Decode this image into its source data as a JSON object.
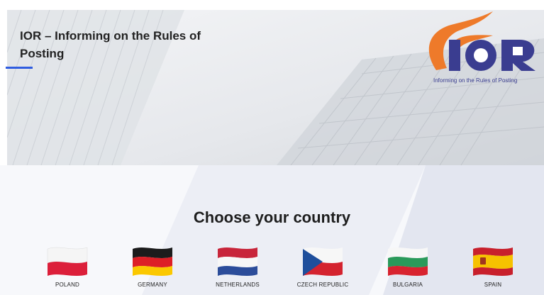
{
  "hero": {
    "title": "IOR – Informing on the Rules of Posting",
    "accent_color": "#2f5ce0"
  },
  "logo": {
    "letters": "IOR",
    "tagline": "Informing on the Rules of Posting",
    "colors": {
      "orange": "#ee7a2a",
      "navy": "#3a3d90"
    }
  },
  "section": {
    "heading": "Choose your country"
  },
  "countries": [
    {
      "name": "POLAND",
      "flag": "pl"
    },
    {
      "name": "GERMANY",
      "flag": "de"
    },
    {
      "name": "NETHERLANDS",
      "flag": "nl"
    },
    {
      "name": "CZECH REPUBLIC",
      "flag": "cz"
    },
    {
      "name": "BULGARIA",
      "flag": "bg"
    },
    {
      "name": "SPAIN",
      "flag": "es"
    }
  ]
}
